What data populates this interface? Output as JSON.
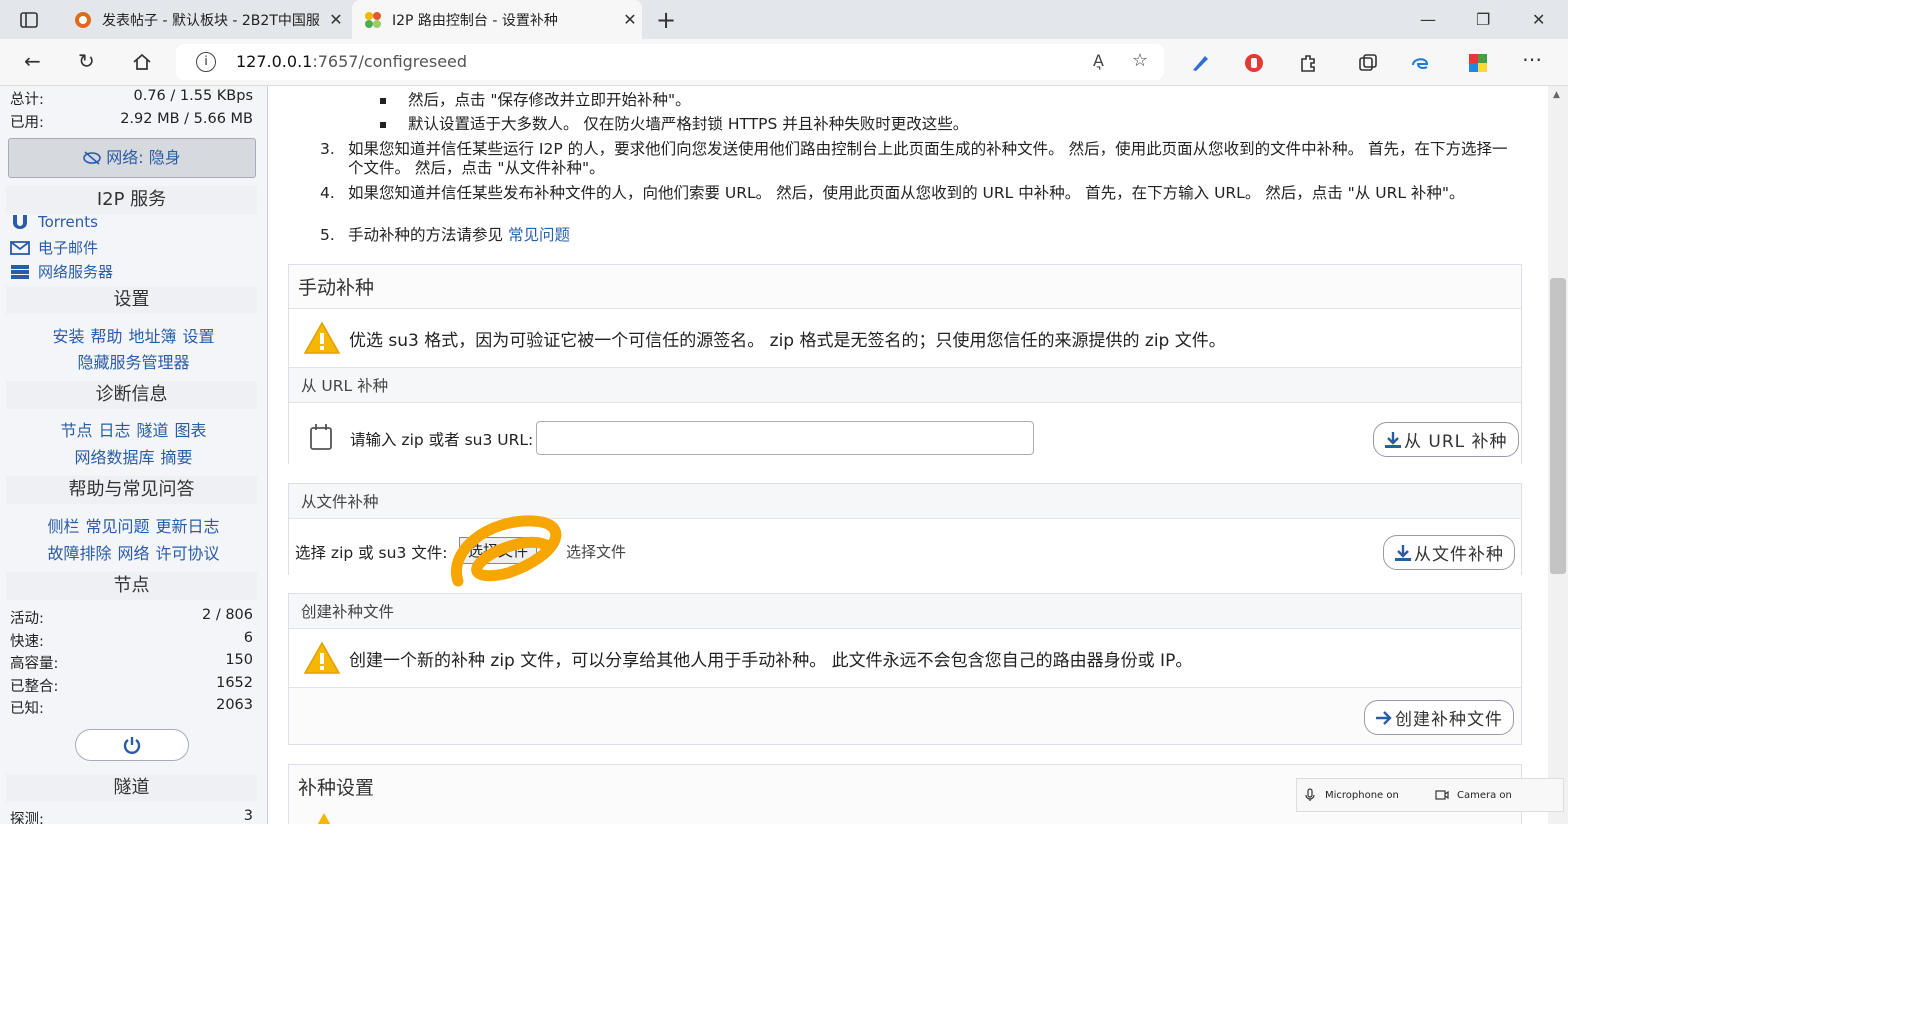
{
  "browser": {
    "tabs": [
      {
        "title": "发表帖子 - 默认板块 - 2B2T中国服"
      },
      {
        "title": "I2P 路由控制台 - 设置补种"
      }
    ],
    "url_host": "127.0.0.1",
    "url_rest": ":7657/configreseed",
    "read_aloud": "A͉"
  },
  "sidebar": {
    "stats": [
      {
        "label": "总计:",
        "value": "0.76 / 1.55 KBps"
      },
      {
        "label": "已用:",
        "value": "2.92 MB / 5.66 MB"
      }
    ],
    "network_button": "网络: 隐身",
    "services_title": "I2P 服务",
    "services": [
      {
        "label": "Torrents",
        "icon": "magnet-icon"
      },
      {
        "label": "电子邮件",
        "icon": "mail-icon"
      },
      {
        "label": "网络服务器",
        "icon": "server-icon"
      }
    ],
    "config_title": "设置",
    "config_links_1": [
      "安装",
      "帮助",
      "地址簿",
      "设置"
    ],
    "config_links_2": [
      "隐藏服务管理器"
    ],
    "diag_title": "诊断信息",
    "diag_links_1": [
      "节点",
      "日志",
      "隧道",
      "图表"
    ],
    "diag_links_2": [
      "网络数据库",
      "摘要"
    ],
    "help_title": "帮助与常见问答",
    "help_links_1": [
      "侧栏",
      "常见问题",
      "更新日志"
    ],
    "help_links_2": [
      "故障排除",
      "网络",
      "许可协议"
    ],
    "peers_title": "节点",
    "peers": [
      {
        "label": "活动:",
        "value": "2 / 806"
      },
      {
        "label": "快速:",
        "value": "6"
      },
      {
        "label": "高容量:",
        "value": "150"
      },
      {
        "label": "已整合:",
        "value": "1652"
      },
      {
        "label": "已知:",
        "value": "2063"
      }
    ],
    "tunnels_title": "隧道",
    "tunnels": [
      {
        "label": "探测:",
        "value": "3"
      }
    ]
  },
  "main": {
    "bullets": [
      "然后，点击 \"保存修改并立即开始补种\"。",
      "默认设置适于大多数人。 仅在防火墙严格封锁 HTTPS 并且补种失败时更改这些。"
    ],
    "items": [
      {
        "n": "3.",
        "text": "如果您知道并信任某些运行 I2P 的人，要求他们向您发送使用他们路由控制台上此页面生成的补种文件。 然后，使用此页面从您收到的文件中补种。 首先，在下方选择一个文件。 然后，点击 \"从文件补种\"。"
      },
      {
        "n": "4.",
        "text": "如果您知道并信任某些发布补种文件的人，向他们索要 URL。 然后，使用此页面从您收到的 URL 中补种。 首先，在下方输入 URL。 然后，点击 \"从 URL 补种\"。"
      },
      {
        "n": "5.",
        "text": "手动补种的方法请参见 ",
        "link": "常见问题"
      }
    ],
    "manual_title": "手动补种",
    "manual_warning": "优选 su3 格式，因为可验证它被一个可信任的源签名。 zip 格式是无签名的；只使用您信任的来源提供的 zip 文件。",
    "url_section": "从 URL 补种",
    "url_label": "请输入 zip 或者 su3 URL:",
    "url_value": "",
    "url_button": "从 URL 补种",
    "file_section": "从文件补种",
    "file_label": "选择 zip 或 su3 文件:",
    "file_choose": "选择文件",
    "file_status": "选择文件",
    "file_button": "从文件补种",
    "create_section": "创建补种文件",
    "create_warning": "创建一个新的补种 zip 文件，可以分享给其他人用于手动补种。 此文件永远不会包含您自己的路由器身份或 IP。",
    "create_button": "创建补种文件",
    "settings_title": "补种设置"
  },
  "notify": {
    "mic": "Microphone on",
    "camera": "Camera on"
  },
  "colors": {
    "link": "#2a5da8",
    "warning": "#f5b700",
    "annotation": "#f7a600"
  }
}
